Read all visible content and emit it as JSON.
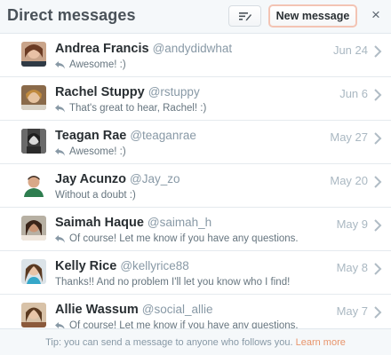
{
  "header": {
    "title": "Direct messages",
    "new_message_label": "New message",
    "close_glyph": "×",
    "compose_icon": "compose-icon"
  },
  "conversations": [
    {
      "name": "Andrea Francis",
      "handle": "@andydidwhat",
      "snippet": "Awesome! :)",
      "replied": true,
      "date": "Jun 24"
    },
    {
      "name": "Rachel Stuppy",
      "handle": "@rstuppy",
      "snippet": "That's great to hear, Rachel! :)",
      "replied": true,
      "date": "Jun 6"
    },
    {
      "name": "Teagan Rae",
      "handle": "@teaganrae",
      "snippet": "Awesome! :)",
      "replied": true,
      "date": "May 27"
    },
    {
      "name": "Jay Acunzo",
      "handle": "@Jay_zo",
      "snippet": "Without a doubt :)",
      "replied": false,
      "date": "May 20"
    },
    {
      "name": "Saimah Haque",
      "handle": "@saimah_h",
      "snippet": "Of course! Let me know if you have any questions.",
      "replied": true,
      "date": "May 9"
    },
    {
      "name": "Kelly Rice",
      "handle": "@kellyrice88",
      "snippet": "Thanks!! And no problem I'll let you know who I find!",
      "replied": false,
      "date": "May 8"
    },
    {
      "name": "Allie Wassum",
      "handle": "@social_allie",
      "snippet": "Of course! Let me know if you have any questions.",
      "replied": true,
      "date": "May 7"
    }
  ],
  "footer": {
    "tip": "Tip: you can send a message to anyone who follows you.",
    "learn_more": "Learn more"
  },
  "colors": {
    "accent": "#e8946b",
    "header_bg": "#f5f8fa",
    "muted": "#8899a6"
  }
}
